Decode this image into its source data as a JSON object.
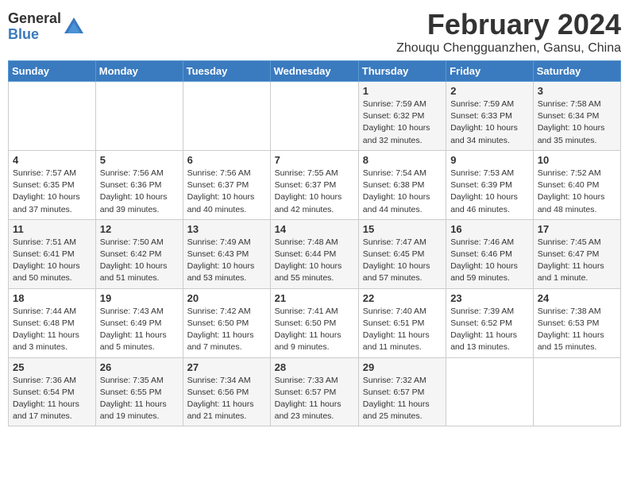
{
  "header": {
    "logo_general": "General",
    "logo_blue": "Blue",
    "month_title": "February 2024",
    "location": "Zhouqu Chengguanzhen, Gansu, China"
  },
  "weekdays": [
    "Sunday",
    "Monday",
    "Tuesday",
    "Wednesday",
    "Thursday",
    "Friday",
    "Saturday"
  ],
  "weeks": [
    [
      {
        "day": "",
        "info": ""
      },
      {
        "day": "",
        "info": ""
      },
      {
        "day": "",
        "info": ""
      },
      {
        "day": "",
        "info": ""
      },
      {
        "day": "1",
        "info": "Sunrise: 7:59 AM\nSunset: 6:32 PM\nDaylight: 10 hours\nand 32 minutes."
      },
      {
        "day": "2",
        "info": "Sunrise: 7:59 AM\nSunset: 6:33 PM\nDaylight: 10 hours\nand 34 minutes."
      },
      {
        "day": "3",
        "info": "Sunrise: 7:58 AM\nSunset: 6:34 PM\nDaylight: 10 hours\nand 35 minutes."
      }
    ],
    [
      {
        "day": "4",
        "info": "Sunrise: 7:57 AM\nSunset: 6:35 PM\nDaylight: 10 hours\nand 37 minutes."
      },
      {
        "day": "5",
        "info": "Sunrise: 7:56 AM\nSunset: 6:36 PM\nDaylight: 10 hours\nand 39 minutes."
      },
      {
        "day": "6",
        "info": "Sunrise: 7:56 AM\nSunset: 6:37 PM\nDaylight: 10 hours\nand 40 minutes."
      },
      {
        "day": "7",
        "info": "Sunrise: 7:55 AM\nSunset: 6:37 PM\nDaylight: 10 hours\nand 42 minutes."
      },
      {
        "day": "8",
        "info": "Sunrise: 7:54 AM\nSunset: 6:38 PM\nDaylight: 10 hours\nand 44 minutes."
      },
      {
        "day": "9",
        "info": "Sunrise: 7:53 AM\nSunset: 6:39 PM\nDaylight: 10 hours\nand 46 minutes."
      },
      {
        "day": "10",
        "info": "Sunrise: 7:52 AM\nSunset: 6:40 PM\nDaylight: 10 hours\nand 48 minutes."
      }
    ],
    [
      {
        "day": "11",
        "info": "Sunrise: 7:51 AM\nSunset: 6:41 PM\nDaylight: 10 hours\nand 50 minutes."
      },
      {
        "day": "12",
        "info": "Sunrise: 7:50 AM\nSunset: 6:42 PM\nDaylight: 10 hours\nand 51 minutes."
      },
      {
        "day": "13",
        "info": "Sunrise: 7:49 AM\nSunset: 6:43 PM\nDaylight: 10 hours\nand 53 minutes."
      },
      {
        "day": "14",
        "info": "Sunrise: 7:48 AM\nSunset: 6:44 PM\nDaylight: 10 hours\nand 55 minutes."
      },
      {
        "day": "15",
        "info": "Sunrise: 7:47 AM\nSunset: 6:45 PM\nDaylight: 10 hours\nand 57 minutes."
      },
      {
        "day": "16",
        "info": "Sunrise: 7:46 AM\nSunset: 6:46 PM\nDaylight: 10 hours\nand 59 minutes."
      },
      {
        "day": "17",
        "info": "Sunrise: 7:45 AM\nSunset: 6:47 PM\nDaylight: 11 hours\nand 1 minute."
      }
    ],
    [
      {
        "day": "18",
        "info": "Sunrise: 7:44 AM\nSunset: 6:48 PM\nDaylight: 11 hours\nand 3 minutes."
      },
      {
        "day": "19",
        "info": "Sunrise: 7:43 AM\nSunset: 6:49 PM\nDaylight: 11 hours\nand 5 minutes."
      },
      {
        "day": "20",
        "info": "Sunrise: 7:42 AM\nSunset: 6:50 PM\nDaylight: 11 hours\nand 7 minutes."
      },
      {
        "day": "21",
        "info": "Sunrise: 7:41 AM\nSunset: 6:50 PM\nDaylight: 11 hours\nand 9 minutes."
      },
      {
        "day": "22",
        "info": "Sunrise: 7:40 AM\nSunset: 6:51 PM\nDaylight: 11 hours\nand 11 minutes."
      },
      {
        "day": "23",
        "info": "Sunrise: 7:39 AM\nSunset: 6:52 PM\nDaylight: 11 hours\nand 13 minutes."
      },
      {
        "day": "24",
        "info": "Sunrise: 7:38 AM\nSunset: 6:53 PM\nDaylight: 11 hours\nand 15 minutes."
      }
    ],
    [
      {
        "day": "25",
        "info": "Sunrise: 7:36 AM\nSunset: 6:54 PM\nDaylight: 11 hours\nand 17 minutes."
      },
      {
        "day": "26",
        "info": "Sunrise: 7:35 AM\nSunset: 6:55 PM\nDaylight: 11 hours\nand 19 minutes."
      },
      {
        "day": "27",
        "info": "Sunrise: 7:34 AM\nSunset: 6:56 PM\nDaylight: 11 hours\nand 21 minutes."
      },
      {
        "day": "28",
        "info": "Sunrise: 7:33 AM\nSunset: 6:57 PM\nDaylight: 11 hours\nand 23 minutes."
      },
      {
        "day": "29",
        "info": "Sunrise: 7:32 AM\nSunset: 6:57 PM\nDaylight: 11 hours\nand 25 minutes."
      },
      {
        "day": "",
        "info": ""
      },
      {
        "day": "",
        "info": ""
      }
    ]
  ]
}
